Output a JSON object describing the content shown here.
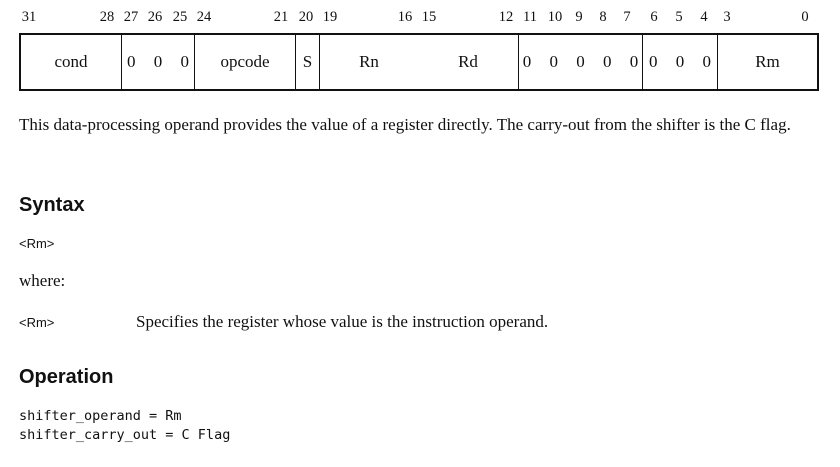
{
  "encoding": {
    "bit_numbers": [
      "31",
      "28",
      "27",
      "26",
      "25",
      "24",
      "21",
      "20",
      "19",
      "16",
      "15",
      "12",
      "11",
      "10",
      "9",
      "8",
      "7",
      "6",
      "5",
      "4",
      "3",
      "0"
    ],
    "fields": [
      {
        "label": "cond"
      },
      {
        "label": "0 0 0"
      },
      {
        "label": "opcode"
      },
      {
        "label": "S"
      },
      {
        "label": "Rn"
      },
      {
        "label": "Rd"
      },
      {
        "label": "0 0 0 0 0"
      },
      {
        "label": "0 0 0"
      },
      {
        "label": "Rm"
      }
    ]
  },
  "description": "This data-processing operand provides the value of a register directly. The carry-out from the shifter is the C flag.",
  "syntax": {
    "heading": "Syntax",
    "form": "<Rm>",
    "where_label": "where:",
    "definitions": [
      {
        "term": "<Rm>",
        "text": "Specifies the register whose value is the instruction operand."
      }
    ]
  },
  "operation": {
    "heading": "Operation",
    "lines": [
      "shifter_operand = Rm",
      "shifter_carry_out = C Flag"
    ]
  }
}
